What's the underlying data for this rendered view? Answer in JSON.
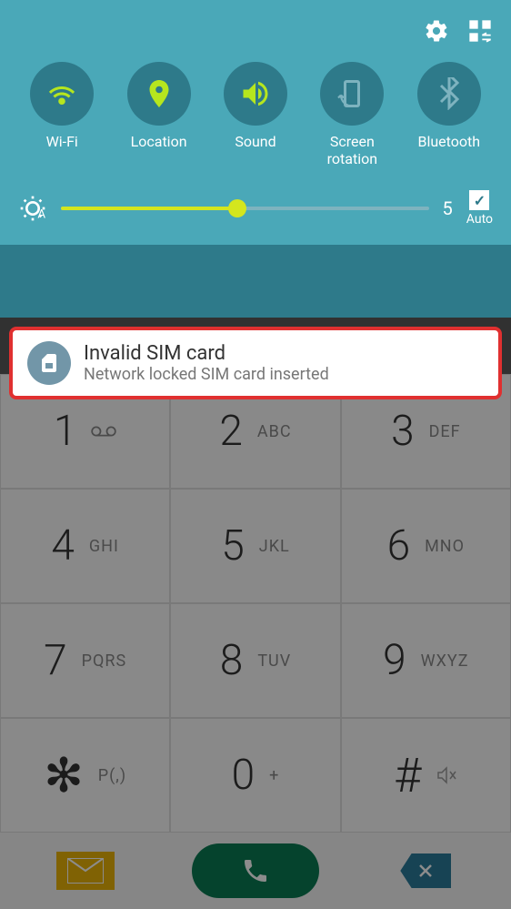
{
  "toggles": {
    "wifi": "Wi-Fi",
    "location": "Location",
    "sound": "Sound",
    "rotation": "Screen\nrotation",
    "bluetooth": "Bluetooth"
  },
  "brightness": {
    "value": "5",
    "auto_label": "Auto"
  },
  "notification": {
    "title": "Invalid SIM card",
    "subtitle": "Network locked SIM card inserted"
  },
  "keypad": [
    {
      "digit": "1",
      "letters": "",
      "vm": true
    },
    {
      "digit": "2",
      "letters": "ABC"
    },
    {
      "digit": "3",
      "letters": "DEF"
    },
    {
      "digit": "4",
      "letters": "GHI"
    },
    {
      "digit": "5",
      "letters": "JKL"
    },
    {
      "digit": "6",
      "letters": "MNO"
    },
    {
      "digit": "7",
      "letters": "PQRS"
    },
    {
      "digit": "8",
      "letters": "TUV"
    },
    {
      "digit": "9",
      "letters": "WXYZ"
    },
    {
      "symbol": "✻",
      "letters": "P(,)"
    },
    {
      "digit": "0",
      "letters": "+"
    },
    {
      "symbol": "#",
      "mute": true
    }
  ]
}
